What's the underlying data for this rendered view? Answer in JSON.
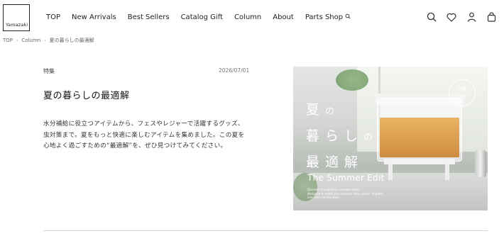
{
  "logo": {
    "text": "Yamazaki"
  },
  "nav": {
    "items": [
      "TOP",
      "New Arrivals",
      "Best Sellers",
      "Catalog Gift",
      "Column",
      "About"
    ],
    "parts_shop": "Parts Shop"
  },
  "header_icons": [
    "search-icon",
    "heart-icon",
    "user-icon",
    "bag-icon"
  ],
  "breadcrumb": [
    "TOP",
    "Column",
    "夏の暮らしの最適解"
  ],
  "article": {
    "category": "特集",
    "date": "2026/07/01",
    "title": "夏の暮らしの最適解",
    "description": "水分補給に役立つアイテムから、フェスやレジャーで活躍するグッズ、虫対策まで。夏をもっと快適に楽しむアイテムを集めました。この夏を心地よく過ごすための“最適解”を、ぜひ見つけてみてください。"
  },
  "feature": {
    "badge_top": "特集",
    "badge_bottom": "July",
    "jp_line1_a": "夏",
    "jp_line1_b": "の",
    "jp_line2_a": "暮らし",
    "jp_line2_b": "の",
    "jp_line3": "最適解",
    "subtitle": "The Summer Edit",
    "desc_line1": "Discover thoughtfully selected items",
    "desc_line2": "designed to make your summer days easier, brighter,",
    "desc_line3": "and more comfortable."
  },
  "colors": {
    "text": "#222222",
    "rule": "#d7d7d7",
    "white": "#ffffff"
  }
}
